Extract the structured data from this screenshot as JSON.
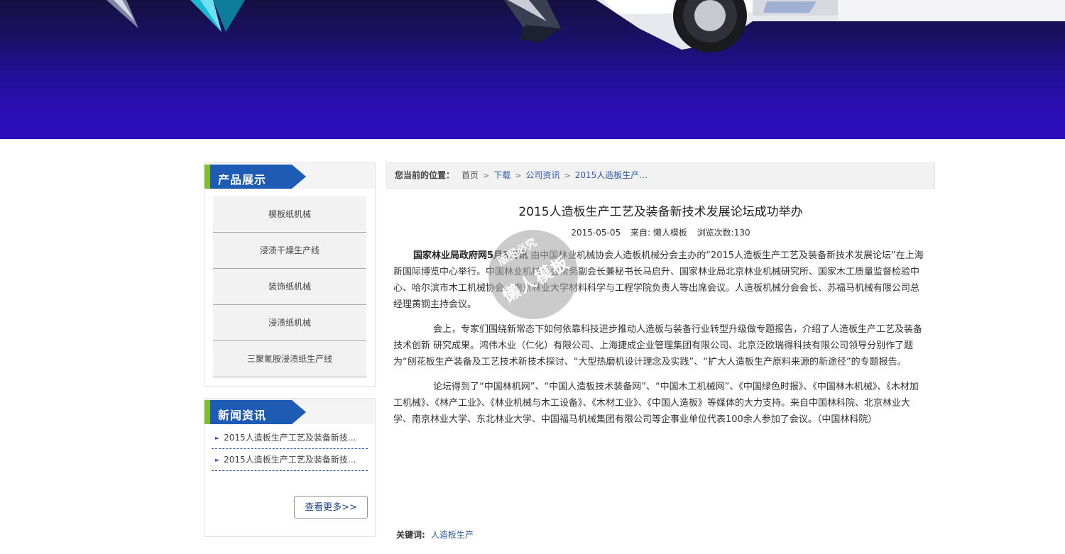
{
  "sidebar": {
    "products": {
      "title": "产品展示",
      "items": [
        "模板纸机械",
        "浸渍干燥生产线",
        "装饰纸机械",
        "浸渍纸机械",
        "三聚氰胺浸渍纸生产线"
      ]
    },
    "news": {
      "title": "新闻资讯",
      "items": [
        "2015人造板生产工艺及装备新技…",
        "2015人造板生产工艺及装备新技…"
      ],
      "more_label": "查看更多>>"
    }
  },
  "breadcrumb": {
    "label": "您当前的位置：",
    "items": [
      "首页",
      "下载",
      "公司资讯",
      "2015人造板生产…"
    ]
  },
  "article": {
    "title": "2015人造板生产工艺及装备新技术发展论坛成功举办",
    "date": "2015-05-05",
    "source": "来自: 懒人模板",
    "views": "浏览次数:130",
    "p1_bold": "国家林业局政府网5月5日讯",
    "p1_rest": " 由中国林业机械协会人造板机械分会主办的“2015人造板生产工艺及装备新技术发展论坛”在上海新国际博览中心举行。中国林业机械协会常务副会长兼秘书长马启升、国家林业局北京林业机械研究所、国家木工质量监督检验中心、哈尔滨市木工机械协会、南京林业大学材料科学与工程学院负责人等出席会议。人造板机械分会会长、苏福马机械有限公司总经理黄钢主持会议。",
    "p2": "会上，专家们围绕新常态下如何依靠科技进步推动人造板与装备行业转型升级做专题报告，介绍了人造板生产工艺及装备技术创新 研究成果。鸿伟木业（仁化）有限公司、上海捷成企业管理集团有限公司、北京泛欧瑞得科技有限公司领导分别作了题为“刨花板生产装备及工艺技术新技术探讨、“大型热磨机设计理念及实践”、“扩大人造板生产原料来源的新途径”的专题报告。",
    "p3": "论坛得到了“中国林机网”、“中国人造板技术装备网”、“中国木工机械网”、《中国绿色时报》、《中国林木机械》、《木材加工机械》、《林产工业》、《林业机械与木工设备》、《木材工业》、《中国人造板》等媒体的大力支持。来自中国林科院、北京林业大学、南京林业大学、东北林业大学、中国福马机械集团有限公司等企事业单位代表100余人参加了会议。（中国林科院）",
    "keywords_label": "关键词:",
    "keyword": "人造板生产"
  },
  "watermark": {
    "line1": "版图必究",
    "line2": "懒人模板"
  },
  "colors": {
    "accent_blue": "#1e5bb5",
    "link_blue": "#2b58a8",
    "accent_green": "#7fbd2b",
    "banner_purple": "#2a0eb5"
  }
}
